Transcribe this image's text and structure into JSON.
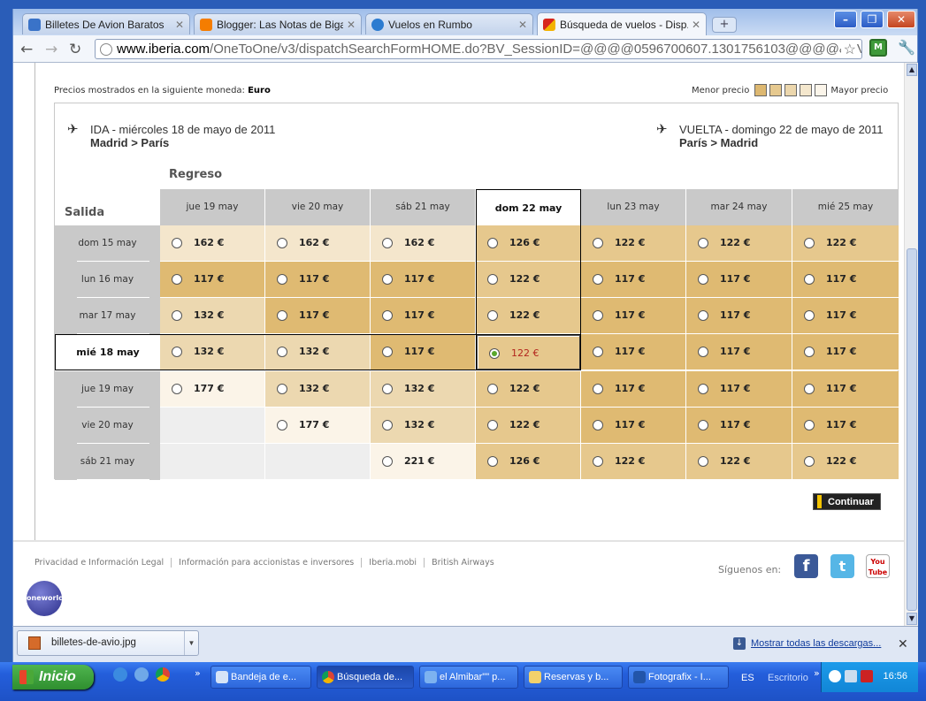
{
  "browser": {
    "tabs": [
      {
        "label": "Billetes De Avion Baratos",
        "icon_color": "#3a73c8",
        "icon": "cheap-flights-icon"
      },
      {
        "label": "Blogger: Las Notas de Biga...",
        "icon_color": "#f57d00",
        "icon": "blogger-icon"
      },
      {
        "label": "Vuelos en Rumbo",
        "icon_color": "#2b7bd0",
        "icon": "globe-icon"
      },
      {
        "label": "Búsqueda de vuelos - Disp...",
        "icon_color": "#d7261d",
        "icon": "iberia-icon"
      }
    ],
    "new_tab": "+",
    "url_domain": "www.iberia.com",
    "url_rest": "/OneToOne/v3/dispatchSearchFormHOME.do?BV_SessionID=@@@@0596700607.1301756103@@@@&BV_Engine"
  },
  "page": {
    "currency_label": "Precios mostrados en la siguiente moneda: ",
    "currency_value": "Euro",
    "legend_low": "Menor precio",
    "legend_high": "Mayor precio",
    "legend_colors": [
      "#ddb871",
      "#e6c98f",
      "#ecd7ad",
      "#f4e7cd",
      "#fbf5ea"
    ],
    "outbound": {
      "line1": "IDA - miércoles 18 de mayo de 2011",
      "line2": "Madrid > París"
    },
    "inbound": {
      "line1": "VUELTA - domingo 22 de mayo de 2011",
      "line2": "París > Madrid"
    },
    "regreso_label": "Regreso",
    "salida_label": "Salida",
    "return_dates": [
      "jue 19 may",
      "vie 20 may",
      "sáb 21 may",
      "dom 22 may",
      "lun 23 may",
      "mar 24 may",
      "mié 25 may"
    ],
    "selected_return_index": 3,
    "departure_dates": [
      "dom 15 may",
      "lun 16 may",
      "mar 17 may",
      "mié 18 may",
      "jue 19 may",
      "vie 20 may",
      "sáb 21 may"
    ],
    "selected_departure_index": 3,
    "prices": [
      [
        "162 €",
        "162 €",
        "162 €",
        "126 €",
        "122 €",
        "122 €",
        "122 €"
      ],
      [
        "117 €",
        "117 €",
        "117 €",
        "122 €",
        "117 €",
        "117 €",
        "117 €"
      ],
      [
        "132 €",
        "117 €",
        "117 €",
        "122 €",
        "117 €",
        "117 €",
        "117 €"
      ],
      [
        "132 €",
        "132 €",
        "117 €",
        "122 €",
        "117 €",
        "117 €",
        "117 €"
      ],
      [
        "177 €",
        "132 €",
        "132 €",
        "122 €",
        "117 €",
        "117 €",
        "117 €"
      ],
      [
        null,
        "177 €",
        "132 €",
        "122 €",
        "117 €",
        "117 €",
        "117 €"
      ],
      [
        null,
        null,
        "221 €",
        "126 €",
        "122 €",
        "122 €",
        "122 €"
      ]
    ],
    "price_tier_colors": {
      "117 €": "#dfba72",
      "122 €": "#e6c88d",
      "126 €": "#e6c88d",
      "132 €": "#ecd8b0",
      "162 €": "#f4e6cc",
      "177 €": "#fbf4e8",
      "221 €": "#fbf4e8"
    },
    "continue_button": "Continuar"
  },
  "footer": {
    "links": [
      "Privacidad e Información Legal",
      "Información para accionistas e inversores",
      "Iberia.mobi",
      "British Airways"
    ],
    "oneworld": "oneworld",
    "follow_label": "Síguenos en:",
    "social": [
      "f",
      "t",
      "You Tube"
    ]
  },
  "downloads": {
    "file": "billetes-de-avio.jpg",
    "show_all": "Mostrar todas las descargas..."
  },
  "taskbar": {
    "start": "Inicio",
    "buttons": [
      "Bandeja de e...",
      "Búsqueda de...",
      "el Almibar\"\" p...",
      "Reservas y b...",
      "Fotografix - I..."
    ],
    "lang": "ES",
    "desktop": "Escritorio",
    "clock": "16:56"
  }
}
